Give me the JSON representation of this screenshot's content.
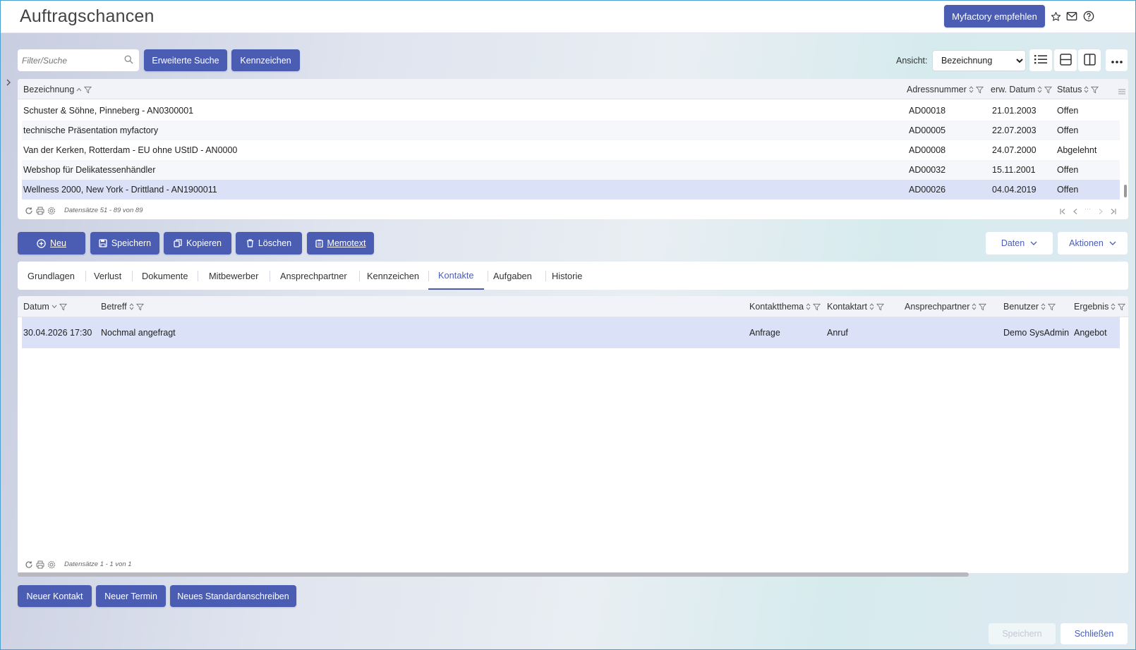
{
  "header": {
    "title": "Auftragschancen",
    "recommend_label": "Myfactory empfehlen"
  },
  "toolbar": {
    "search_placeholder": "Filter/Suche",
    "advanced_search_label": "Erweiterte Suche",
    "tags_label": "Kennzeichen",
    "view_label": "Ansicht:",
    "view_value": "Bezeichnung"
  },
  "main_grid": {
    "columns": [
      "Bezeichnung",
      "Adressnummer",
      "erw. Datum",
      "Status"
    ],
    "rows": [
      {
        "bezeichnung": "Schuster & Söhne, Pinneberg - AN0300001",
        "adresse": "AD00018",
        "datum": "21.01.2003",
        "status": "Offen"
      },
      {
        "bezeichnung": "technische Präsentation myfactory",
        "adresse": "AD00005",
        "datum": "22.07.2003",
        "status": "Offen"
      },
      {
        "bezeichnung": "Van der Kerken, Rotterdam - EU ohne UStID - AN0000",
        "adresse": "AD00008",
        "datum": "24.07.2000",
        "status": "Abgelehnt"
      },
      {
        "bezeichnung": "Webshop für Delikatessenhändler",
        "adresse": "AD00032",
        "datum": "15.11.2001",
        "status": "Offen"
      },
      {
        "bezeichnung": "Wellness 2000, New York - Drittland - AN1900011",
        "adresse": "AD00026",
        "datum": "04.04.2019",
        "status": "Offen"
      }
    ],
    "footer_text": "Datensätze 51 - 89 von 89",
    "pager_ellipsis": "···"
  },
  "actions": {
    "new": "Neu",
    "save": "Speichern",
    "copy": "Kopieren",
    "delete": "Löschen",
    "memo": "Memotext",
    "data": "Daten",
    "more_actions": "Aktionen"
  },
  "tabs": [
    "Grundlagen",
    "Verlust",
    "Dokumente",
    "Mitbewerber",
    "Ansprechpartner",
    "Kennzeichen",
    "Kontakte",
    "Aufgaben",
    "Historie"
  ],
  "active_tab": "Kontakte",
  "contacts_grid": {
    "columns": [
      "Datum",
      "Betreff",
      "Kontaktthema",
      "Kontaktart",
      "Ansprechpartner",
      "Benutzer",
      "Ergebnis"
    ],
    "rows": [
      {
        "datum": "30.04.2026 17:30",
        "betreff": "Nochmal angefragt",
        "thema": "Anfrage",
        "art": "Anruf",
        "ansprechpartner": "",
        "benutzer": "Demo SysAdmin",
        "ergebnis": "Angebot"
      }
    ],
    "footer_text": "Datensätze 1 - 1 von 1"
  },
  "contact_buttons": {
    "new_contact": "Neuer Kontakt",
    "new_appointment": "Neuer Termin",
    "new_letter": "Neues Standardanschreiben"
  },
  "bottom": {
    "save": "Speichern",
    "close": "Schließen"
  },
  "colors": {
    "accent": "#4a5db3",
    "selection": "#dbe2f7"
  }
}
